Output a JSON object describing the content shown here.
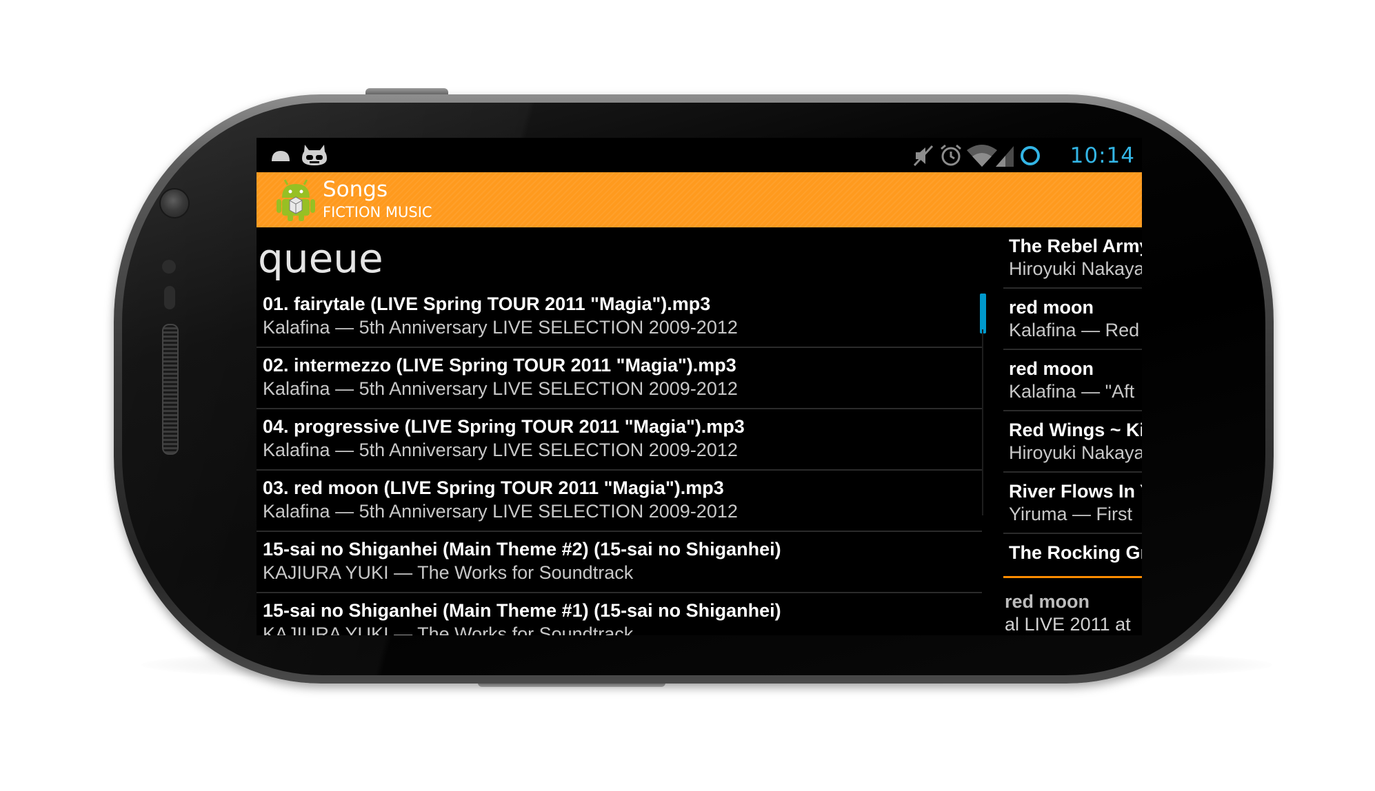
{
  "status_bar": {
    "time": "10:14",
    "left_icons": [
      "android-notification-icon",
      "cyanogen-mascot-icon"
    ],
    "right_icons": [
      "muted-speaker-icon",
      "alarm-icon",
      "wifi-icon",
      "signal-icon",
      "sync-ring-icon"
    ],
    "accent_color": "#33b5e5"
  },
  "action_bar": {
    "title": "Songs",
    "subtitle": "FICTION MUSIC",
    "background_color": "#ff9a1e",
    "icon": "android-app-icon"
  },
  "queue": {
    "heading": "queue",
    "items": [
      {
        "title": "01. fairytale (LIVE Spring TOUR 2011 \"Magia\").mp3",
        "subtitle": "Kalafina — 5th Anniversary LIVE SELECTION 2009-2012"
      },
      {
        "title": "02. intermezzo (LIVE Spring TOUR 2011 \"Magia\").mp3",
        "subtitle": "Kalafina — 5th Anniversary LIVE SELECTION 2009-2012"
      },
      {
        "title": "04. progressive  (LIVE Spring TOUR 2011 \"Magia\").mp3",
        "subtitle": "Kalafina — 5th Anniversary LIVE SELECTION 2009-2012"
      },
      {
        "title": "03. red moon  (LIVE Spring TOUR 2011 \"Magia\").mp3",
        "subtitle": "Kalafina — 5th Anniversary LIVE SELECTION 2009-2012"
      },
      {
        "title": "15-sai no Shiganhei (Main Theme #2) (15-sai no Shiganhei)",
        "subtitle": "KAJIURA YUKI — The Works for Soundtrack"
      },
      {
        "title": "15-sai no Shiganhei (Main Theme #1) (15-sai no Shiganhei)",
        "subtitle": "KAJIURA YUKI — The Works for Soundtrack"
      }
    ]
  },
  "songs_pane": {
    "items": [
      {
        "title": "The Rebel Army",
        "subtitle": "Hiroyuki Nakaya"
      },
      {
        "title": "red moon",
        "subtitle": "Kalafina — Red"
      },
      {
        "title": "red moon",
        "subtitle": "Kalafina — \"Aft"
      },
      {
        "title": "Red Wings ~ Ki",
        "subtitle": "Hiroyuki Nakaya"
      },
      {
        "title": "River Flows In Y",
        "subtitle": "Yiruma — First"
      },
      {
        "title": "The Rocking Gr",
        "subtitle": ""
      }
    ],
    "active_index": 5,
    "active_color": "#ff8c00",
    "now_playing": {
      "title": "red moon",
      "subtitle": "al LIVE 2011 at"
    }
  },
  "scroll_indicator_color": "#0099cc"
}
